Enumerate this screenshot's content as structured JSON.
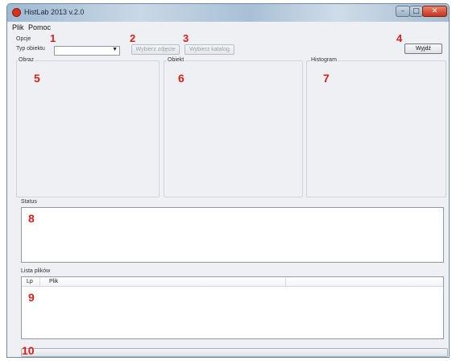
{
  "window": {
    "title": "HistLab 2013 v.2.0"
  },
  "window_controls": {
    "minimize": "–",
    "maximize": "□",
    "close": "✕"
  },
  "menu": {
    "items": [
      "Plik",
      "Pomoc"
    ]
  },
  "options": {
    "group_label": "Opcje",
    "object_type_label": "Typ obiektu",
    "object_type_value": "",
    "select_image_button": "Wybierz zdjęcie",
    "select_folder_button": "Wybierz katalog",
    "exit_button": "Wyjdź"
  },
  "panels": {
    "image": "Obraz",
    "object": "Obiekt",
    "histogram": "Histogram"
  },
  "status": {
    "label": "Status",
    "text": ""
  },
  "file_list": {
    "label": "Lista plików",
    "columns": [
      "Lp",
      "Plik",
      ""
    ]
  },
  "progress": {
    "value": 0
  },
  "annotations": [
    "1",
    "2",
    "3",
    "4",
    "5",
    "6",
    "7",
    "8",
    "9",
    "10"
  ],
  "colors": {
    "annotation": "#d9201b",
    "close_button": "#c4341c"
  },
  "icons": {
    "app": "app-red-circle-icon",
    "dropdown": "chevron-down-icon"
  }
}
